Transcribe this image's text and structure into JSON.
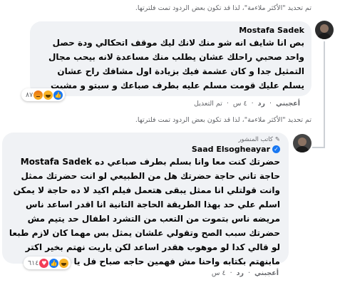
{
  "notices": {
    "top": "تم تحديد \"الأكثر ملاءمة\"، لذا قد تكون بعض الردود تمت فلترتها.",
    "middle": "تم تحديد \"الأكثر ملاءمة\"، لذا قد تكون بعض الردود تمت فلترتها."
  },
  "comment1": {
    "author": "Mostafa Sadek",
    "text": "بص انا شايف انه شو منك لانك ليك موقف اتحكالي ودة حصل واحد صحبي راحلك عشان يطلب منك مساعدة لانه بيحب مجال التمثيل جدا و كان عشمة فيك بزيادة اول مشافك راح عشان يسلم عليك قومت مسلم عليه بطرف صباعك و سبتو و مشيت",
    "actions": {
      "like": "أعجبني",
      "reply": "رد",
      "time": "٤ س",
      "edited": "تم التعديل"
    },
    "reactions": {
      "count": "٨٧",
      "icons": [
        "angry-icon",
        "haha-icon",
        "like-icon"
      ]
    }
  },
  "comment2": {
    "badge": "كاتب المنشور",
    "author": "Saad Elsogheayar",
    "mention": "Mostafa Sadek",
    "text_start": "حضرتك كنت معا وانا بسلم بطرف صباعي ده",
    "text_rest": "حاجة تاني حاجة حضرتك هل من الطبيعي لو انت حضرتك ممثل وانت قولتلي انا ممثل يبقى هتعمل فيلم اكيد لا ده حاجة لا يمكن اسلم علي حد بهذا الطريقة الحاجة التانية انا اقدر اساعد ناس مريضه ناس بتموت من التعب من التشرد اطفال حد يتيم مش حضرتك سبب الصح وتقولي علشان يمثل بس مهما كان لازم طبعا لو قالي كدا لو موهوب هقدر اساعد لكن ياريت نهتم بخير اكتر مابنهتم بكتابه واحنا مش فهمين حاجه صباح فل يا مصطفى",
    "actions": {
      "like": "أعجبني",
      "reply": "رد",
      "time": "٤ س"
    },
    "reactions": {
      "count": "٦١٤",
      "icons": [
        "love-icon",
        "like-icon",
        "haha-icon"
      ]
    }
  },
  "colors": {
    "bubble": "#f0f2f5",
    "secondary_text": "#65676b",
    "verified": "#1877f2"
  }
}
